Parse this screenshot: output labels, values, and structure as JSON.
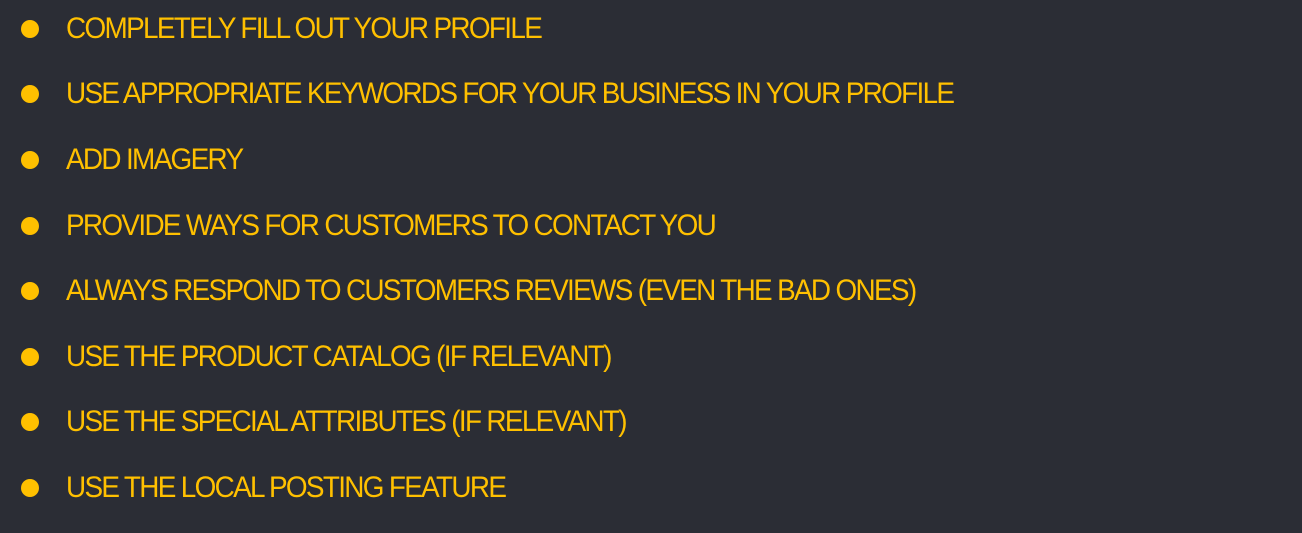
{
  "slide": {
    "bullets": [
      "COMPLETELY FILL OUT YOUR PROFILE",
      "USE APPROPRIATE KEYWORDS FOR YOUR BUSINESS IN YOUR PROFILE",
      "ADD IMAGERY",
      "PROVIDE WAYS FOR CUSTOMERS TO CONTACT YOU",
      "ALWAYS RESPOND TO CUSTOMERS REVIEWS (EVEN THE BAD ONES)",
      "USE THE PRODUCT CATALOG (IF RELEVANT)",
      "USE THE SPECIAL ATTRIBUTES (IF RELEVANT)",
      "USE THE LOCAL POSTING FEATURE"
    ],
    "colors": {
      "background": "#2b2d35",
      "accent": "#ffc000"
    }
  }
}
